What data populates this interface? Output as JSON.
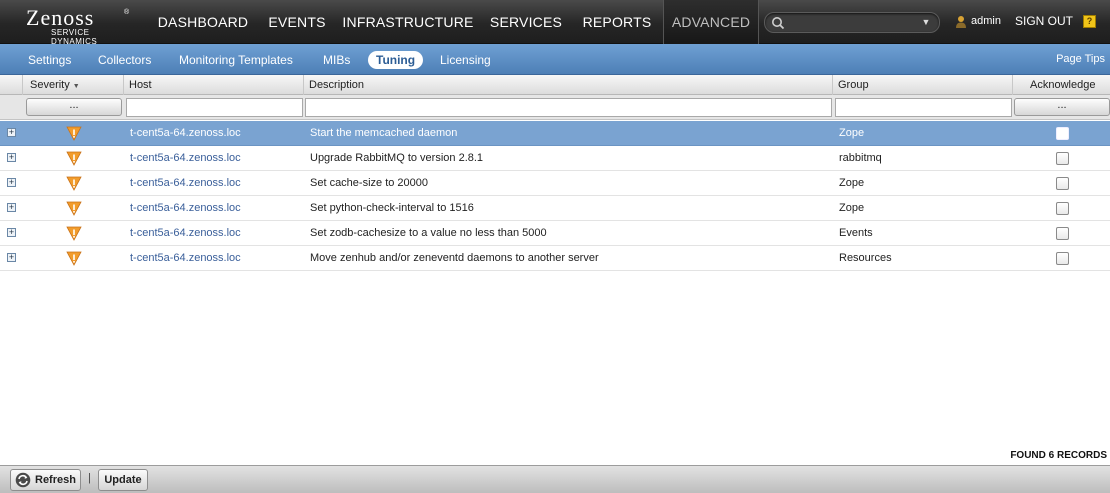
{
  "logo": {
    "main": "Zenoss",
    "sub": "SERVICE DYNAMICS",
    "reg": "®"
  },
  "nav": {
    "items": [
      {
        "label": "DASHBOARD"
      },
      {
        "label": "EVENTS"
      },
      {
        "label": "INFRASTRUCTURE"
      },
      {
        "label": "SERVICES"
      },
      {
        "label": "REPORTS"
      },
      {
        "label": "ADVANCED",
        "active": true
      }
    ],
    "search": {
      "value": "",
      "placeholder": "",
      "icon": "search-icon"
    },
    "user": "admin",
    "signout": "SIGN OUT",
    "help": "?"
  },
  "subnav": {
    "items": [
      {
        "label": "Settings"
      },
      {
        "label": "Collectors"
      },
      {
        "label": "Monitoring Templates"
      },
      {
        "label": "MIBs"
      },
      {
        "label": "Tuning",
        "active": true
      },
      {
        "label": "Licensing"
      }
    ],
    "page_tips": "Page Tips"
  },
  "grid": {
    "columns": {
      "severity": "Severity",
      "host": "Host",
      "description": "Description",
      "group": "Group",
      "acknowledge": "Acknowledge"
    },
    "filters": {
      "severity_button": "...",
      "acknowledge_button": "...",
      "host": "",
      "description": "",
      "group": ""
    },
    "rows": [
      {
        "severity": "warning",
        "host": "t-cent5a-64.zenoss.loc",
        "description": "Start the memcached daemon",
        "group": "Zope",
        "acknowledged": false,
        "selected": true
      },
      {
        "severity": "warning",
        "host": "t-cent5a-64.zenoss.loc",
        "description": "Upgrade RabbitMQ to version 2.8.1",
        "group": "rabbitmq",
        "acknowledged": false
      },
      {
        "severity": "warning",
        "host": "t-cent5a-64.zenoss.loc",
        "description": "Set cache-size to 20000",
        "group": "Zope",
        "acknowledged": false
      },
      {
        "severity": "warning",
        "host": "t-cent5a-64.zenoss.loc",
        "description": "Set python-check-interval to 1516",
        "group": "Zope",
        "acknowledged": false
      },
      {
        "severity": "warning",
        "host": "t-cent5a-64.zenoss.loc",
        "description": "Set zodb-cachesize to a value no less than 5000",
        "group": "Events",
        "acknowledged": false
      },
      {
        "severity": "warning",
        "host": "t-cent5a-64.zenoss.loc",
        "description": "Move zenhub and/or zeneventd daemons to another server",
        "group": "Resources",
        "acknowledged": false
      }
    ],
    "found": "FOUND 6 RECORDS"
  },
  "toolbar": {
    "refresh": "Refresh",
    "separator": "|",
    "update": "Update"
  },
  "colors": {
    "nav_bg": "#262626",
    "subnav_bg": "#5a8bc2",
    "selected_row": "#7aa3d1",
    "warning": "#f29c2b"
  }
}
